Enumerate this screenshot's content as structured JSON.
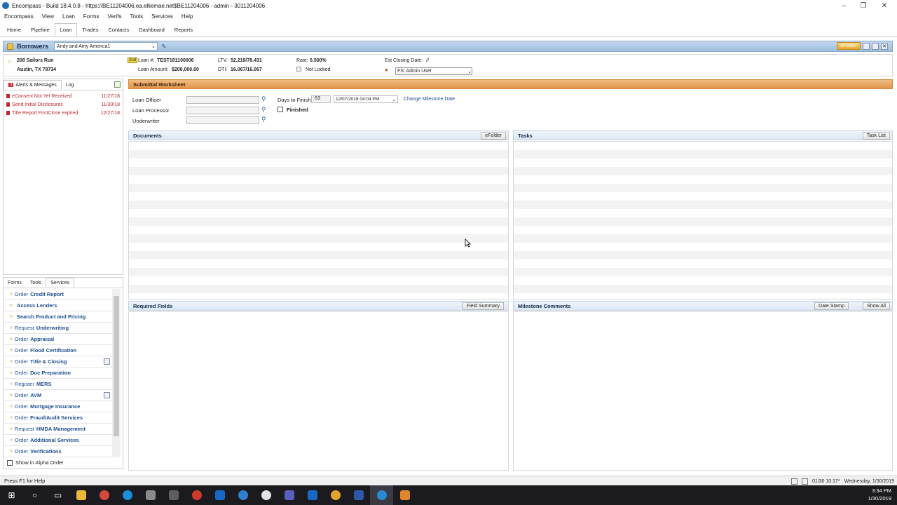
{
  "window": {
    "title": "Encompass - Build 18.4.0.8 - https://BE11204006.ea.elliemae.net$BE11204006 - admin - 3011204006",
    "minimize": "–",
    "maximize": "❐",
    "close": "✕"
  },
  "menu": [
    "Encompass",
    "View",
    "Loan",
    "Forms",
    "Verifs",
    "Tools",
    "Services",
    "Help"
  ],
  "tabs": [
    "Home",
    "Pipeline",
    "Loan",
    "Trades",
    "Contacts",
    "Dashboard",
    "Reports"
  ],
  "active_tab": "Loan",
  "borrowers": {
    "label": "Borrowers",
    "selected": "Andy and Amy America1",
    "efolder": "eFolder"
  },
  "loan_info": {
    "address1": "208 Sailors Run",
    "address2": "Austin, TX 78734",
    "lien": "2nd",
    "loan_num_label": "Loan #:",
    "loan_num": "TEST181100006",
    "loan_amount_label": "Loan Amount:",
    "loan_amount": "$200,000.00",
    "ltv_label": "LTV:",
    "ltv": "52.219/78.431",
    "dti_label": "DTI:",
    "dti": "16.067/16.067",
    "rate_label": "Rate:",
    "rate": "5.500%",
    "lock_status": "Not Locked",
    "closing_label": "Est Closing Date:",
    "closing_value": "//",
    "user_select": "FS: Admin User"
  },
  "left_tabs": {
    "alerts_count": "3",
    "alerts": "Alerts & Messages",
    "log": "Log"
  },
  "alerts": [
    {
      "name": "eConsent Not Yet Received",
      "date": "11/27/18"
    },
    {
      "name": "Send Initial Disclosures",
      "date": "11/30/18"
    },
    {
      "name": "Title Report FirstClose expired",
      "date": "12/27/18"
    }
  ],
  "service_tabs": [
    "Forms",
    "Tools",
    "Services"
  ],
  "active_service_tab": "Services",
  "services": [
    {
      "pre": "Order",
      "bold": "Credit Report"
    },
    {
      "pre": "",
      "bold": "Access Lenders"
    },
    {
      "pre": "",
      "bold": "Search Product and Pricing"
    },
    {
      "pre": "Request",
      "bold": "Underwriting"
    },
    {
      "pre": "Order",
      "bold": "Appraisal"
    },
    {
      "pre": "Order",
      "bold": "Flood Certification"
    },
    {
      "pre": "Order",
      "bold": "Title & Closing"
    },
    {
      "pre": "Order",
      "bold": "Doc Preparation"
    },
    {
      "pre": "Register",
      "bold": "MERS"
    },
    {
      "pre": "Order",
      "bold": "AVM"
    },
    {
      "pre": "Order",
      "bold": "Mortgage Insurance"
    },
    {
      "pre": "Order",
      "bold": "Fraud/Audit Services"
    },
    {
      "pre": "Request",
      "bold": "HMDA Management"
    },
    {
      "pre": "Order",
      "bold": "Additional Services"
    },
    {
      "pre": "Order",
      "bold": "Verifications"
    }
  ],
  "alpha_order": "Show in Alpha Order",
  "worksheet": {
    "title": "Submittal Worksheet",
    "loan_officer": "Loan Officer",
    "loan_processor": "Loan Processor",
    "underwriter": "Underwriter",
    "days_to_finish": "Days to Finish",
    "days_value": "-53",
    "date_value": "12/07/2018 04:04 PM",
    "change_milestone": "Change Milestone Date",
    "finished": "Finished"
  },
  "panels": {
    "documents": "Documents",
    "efolder_btn": "eFolder",
    "tasks": "Tasks",
    "tasklist_btn": "Task List",
    "required": "Required Fields",
    "field_summary": "Field Summary",
    "milestone": "Milestone Comments",
    "date_stamp": "Date Stamp",
    "show_all": "Show All"
  },
  "status": {
    "help": "Press F1 for Help",
    "time": "01/30 10:17*",
    "date": "Wednesday, 1/30/2019"
  },
  "tray": {
    "time": "3:34 PM",
    "date": "1/30/2019"
  },
  "colors": {
    "accent_orange": "#e2954a",
    "header_blue": "#9fbede",
    "alert_red": "#c0282e",
    "link_blue": "#1d4f91"
  }
}
